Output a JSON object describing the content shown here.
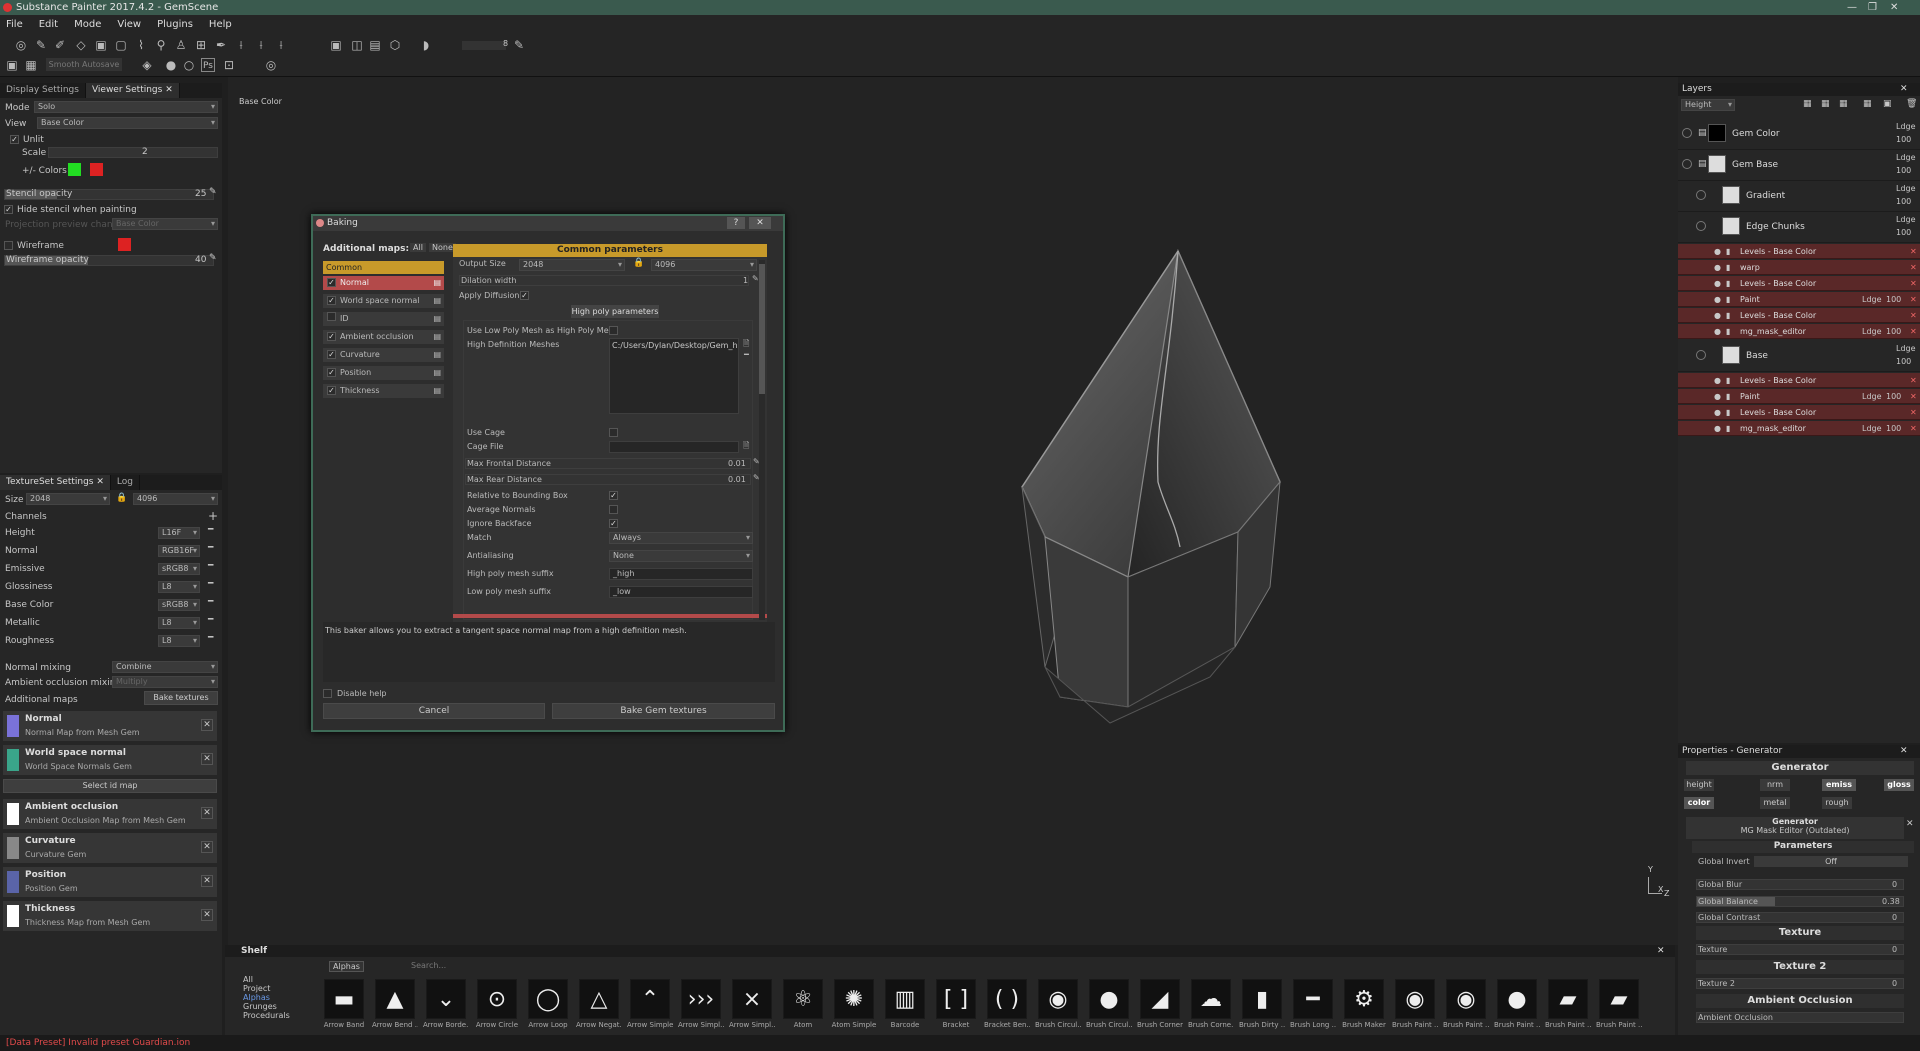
{
  "window": {
    "title": "Substance Painter 2017.4.2 - GemScene"
  },
  "menu": [
    "File",
    "Edit",
    "Mode",
    "View",
    "Plugins",
    "Help"
  ],
  "toolbar": {
    "symmetry_label": "Smooth Autosave",
    "value": "8"
  },
  "viewer": {
    "tabs": [
      "Display Settings",
      "Viewer Settings"
    ],
    "mode_label": "Mode",
    "mode_value": "Solo",
    "view_label": "View",
    "view_value": "Base Color",
    "unlit": "Unlit",
    "scale_label": "Scale",
    "scale_value": "2",
    "colors_label": "+/- Colors",
    "color_pos": "#22dd22",
    "color_neg": "#dd2222",
    "stencil_label": "Stencil opacity",
    "stencil_value": "25",
    "hide_stencil": "Hide stencil when painting",
    "proj_label": "Projection preview channel",
    "proj_value": "Base Color",
    "wireframe_label": "Wireframe",
    "wire_color": "#dd2222",
    "wire_opacity_label": "Wireframe opacity",
    "wire_opacity_value": "40"
  },
  "viewport": {
    "channel_label": "Base Color",
    "axis_y": "Y",
    "axis_x": "X",
    "axis_z": "Z"
  },
  "textureset": {
    "tabs": [
      "TextureSet Settings",
      "Log"
    ],
    "size_label": "Size",
    "size_value": "2048",
    "size_value2": "4096",
    "channels_label": "Channels",
    "channels": [
      {
        "name": "Height",
        "fmt": "L16F"
      },
      {
        "name": "Normal",
        "fmt": "RGB16F"
      },
      {
        "name": "Emissive",
        "fmt": "sRGB8"
      },
      {
        "name": "Glossiness",
        "fmt": "L8"
      },
      {
        "name": "Base Color",
        "fmt": "sRGB8"
      },
      {
        "name": "Metallic",
        "fmt": "L8"
      },
      {
        "name": "Roughness",
        "fmt": "L8"
      }
    ],
    "normal_mixing_label": "Normal mixing",
    "normal_mixing_value": "Combine",
    "ao_mixing_label": "Ambient occlusion mixing",
    "ao_mixing_value": "Multiply",
    "additional_maps_label": "Additional maps",
    "bake_button": "Bake textures",
    "select_id": "Select id map",
    "maps": [
      {
        "name": "Normal",
        "sub": "Normal Map from Mesh Gem",
        "color": "#7a72d8"
      },
      {
        "name": "World space normal",
        "sub": "World Space Normals Gem",
        "color": "#3aa58a"
      },
      {
        "name": "Ambient occlusion",
        "sub": "Ambient Occlusion Map from Mesh Gem",
        "color": "#ffffff"
      },
      {
        "name": "Curvature",
        "sub": "Curvature Gem",
        "color": "#888888"
      },
      {
        "name": "Position",
        "sub": "Position Gem",
        "color": "#5a64a8"
      },
      {
        "name": "Thickness",
        "sub": "Thickness Map from Mesh Gem",
        "color": "#ffffff"
      }
    ]
  },
  "baking": {
    "title": "Baking",
    "additional_maps": "Additional maps:",
    "all": "All",
    "none": "None",
    "common": "Common",
    "bakers": [
      "Normal",
      "World space normal",
      "ID",
      "Ambient occlusion",
      "Curvature",
      "Position",
      "Thickness"
    ],
    "common_params": "Common parameters",
    "output_size_label": "Output Size",
    "output_size_value": "2048",
    "output_size_value2": "4096",
    "dilation_label": "Dilation width",
    "dilation_value": "1",
    "apply_diffusion": "Apply Diffusion",
    "high_poly_params": "High poly parameters",
    "use_low_poly": "Use Low Poly Mesh as High Poly Mesh",
    "hd_meshes_label": "High Definition Meshes",
    "hd_meshes_value": "C:/Users/Dylan/Desktop/Gem_hig",
    "use_cage": "Use Cage",
    "cage_file": "Cage File",
    "max_frontal_label": "Max Frontal Distance",
    "max_frontal_value": "0.01",
    "max_rear_label": "Max Rear Distance",
    "max_rear_value": "0.01",
    "relative_bbox": "Relative to Bounding Box",
    "average_normals": "Average Normals",
    "ignore_backface": "Ignore Backface",
    "match_label": "Match",
    "match_value": "Always",
    "antialiasing_label": "Antialiasing",
    "antialiasing_value": "None",
    "high_suffix_label": "High poly mesh suffix",
    "high_suffix_value": "_high",
    "low_suffix_label": "Low poly mesh suffix",
    "low_suffix_value": "_low",
    "help_text": "This baker allows you to extract a tangent space normal map from a high definition mesh.",
    "disable_help": "Disable help",
    "cancel": "Cancel",
    "bake": "Bake Gem textures"
  },
  "layers": {
    "title": "Layers",
    "blend": "Height",
    "items": [
      {
        "name": "Gem Color",
        "mode": "Ldge",
        "val": "100"
      },
      {
        "name": "Gem Base",
        "mode": "Ldge",
        "val": "100"
      },
      {
        "name": "Gradient",
        "mode": "Ldge",
        "val": "100"
      },
      {
        "name": "Edge Chunks",
        "mode": "Ldge",
        "val": "100"
      }
    ],
    "edge_effects": [
      {
        "name": "Levels - Base Color",
        "mode": "",
        "val": ""
      },
      {
        "name": "warp",
        "mode": "",
        "val": ""
      },
      {
        "name": "Levels - Base Color",
        "mode": "",
        "val": ""
      },
      {
        "name": "Paint",
        "mode": "Ldge",
        "val": "100"
      },
      {
        "name": "Levels - Base Color",
        "mode": "",
        "val": ""
      },
      {
        "name": "mg_mask_editor",
        "mode": "Ldge",
        "val": "100"
      }
    ],
    "base": {
      "name": "Base",
      "mode": "Ldge",
      "val": "100"
    },
    "base_effects": [
      {
        "name": "Levels - Base Color",
        "mode": "",
        "val": ""
      },
      {
        "name": "Paint",
        "mode": "Ldge",
        "val": "100"
      },
      {
        "name": "Levels - Base Color",
        "mode": "",
        "val": ""
      },
      {
        "name": "mg_mask_editor",
        "mode": "Ldge",
        "val": "100"
      }
    ]
  },
  "properties": {
    "title": "Properties - Generator",
    "generator": "Generator",
    "chips": [
      "height",
      "nrm",
      "emiss",
      "gloss",
      "color",
      "metal",
      "rough"
    ],
    "gen_name": "Generator",
    "gen_sub": "MG Mask Editor (Outdated)",
    "parameters": "Parameters",
    "global_invert_label": "Global Invert",
    "global_invert_value": "Off",
    "global_blur_label": "Global Blur",
    "global_blur_value": "0",
    "global_balance_label": "Global Balance",
    "global_balance_value": "0.38",
    "global_contrast_label": "Global Contrast",
    "global_contrast_value": "0",
    "texture_h": "Texture",
    "texture_label": "Texture",
    "texture_value": "0",
    "texture2_h": "Texture 2",
    "texture2_label": "Texture 2",
    "texture2_value": "0",
    "ao_h": "Ambient Occlusion",
    "ao_label": "Ambient Occlusion"
  },
  "shelf": {
    "title": "Shelf",
    "filter": "Alphas",
    "search_placeholder": "Search...",
    "tree": [
      "All",
      "Project",
      "Alphas",
      "Grunges",
      "Procedurals"
    ],
    "items": [
      {
        "name": "Arrow Band",
        "glyph": "▬"
      },
      {
        "name": "Arrow Bend ...",
        "glyph": "▲"
      },
      {
        "name": "Arrow Borde...",
        "glyph": "⌄"
      },
      {
        "name": "Arrow Circle",
        "glyph": "⊙"
      },
      {
        "name": "Arrow Loop",
        "glyph": "◯"
      },
      {
        "name": "Arrow Negat...",
        "glyph": "△"
      },
      {
        "name": "Arrow Simple",
        "glyph": "⌃"
      },
      {
        "name": "Arrow Simpl...",
        "glyph": "›››"
      },
      {
        "name": "Arrow Simpl...",
        "glyph": "⨯"
      },
      {
        "name": "Atom",
        "glyph": "⚛"
      },
      {
        "name": "Atom Simple",
        "glyph": "✺"
      },
      {
        "name": "Barcode",
        "glyph": "▥"
      },
      {
        "name": "Bracket",
        "glyph": "[ ]"
      },
      {
        "name": "Bracket Ben...",
        "glyph": "( )"
      },
      {
        "name": "Brush Circul...",
        "glyph": "◉"
      },
      {
        "name": "Brush Circul...",
        "glyph": "●"
      },
      {
        "name": "Brush Corner",
        "glyph": "◢"
      },
      {
        "name": "Brush Corne...",
        "glyph": "☁"
      },
      {
        "name": "Brush Dirty ...",
        "glyph": "▮"
      },
      {
        "name": "Brush Long ...",
        "glyph": "━"
      },
      {
        "name": "Brush Maker",
        "glyph": "⚙"
      },
      {
        "name": "Brush Paint ...",
        "glyph": "◉"
      },
      {
        "name": "Brush Paint ...",
        "glyph": "◉"
      },
      {
        "name": "Brush Paint ...",
        "glyph": "●"
      },
      {
        "name": "Brush Paint ...",
        "glyph": "▰"
      },
      {
        "name": "Brush Paint ...",
        "glyph": "▰"
      }
    ]
  },
  "status": {
    "text": "[Data Preset] Invalid preset Guardian.ion"
  }
}
